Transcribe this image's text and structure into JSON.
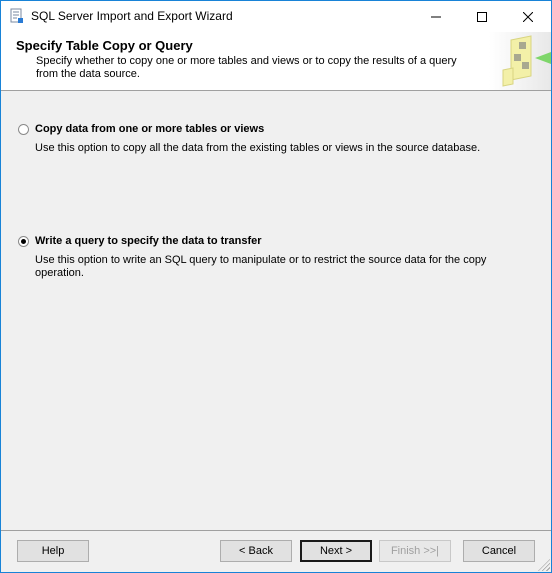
{
  "window": {
    "title": "SQL Server Import and Export Wizard"
  },
  "header": {
    "title": "Specify Table Copy or Query",
    "description": "Specify whether to copy one or more tables and views or to copy the results of a query from the data source."
  },
  "options": [
    {
      "label": "Copy data from one or more tables or views",
      "description": "Use this option to copy all the data from the existing tables or views in the source database.",
      "checked": false
    },
    {
      "label": "Write a query to specify the data to transfer",
      "description": "Use this option to write an SQL query to manipulate or to restrict the source data for the copy operation.",
      "checked": true
    }
  ],
  "buttons": {
    "help": "Help",
    "back": "< Back",
    "next": "Next >",
    "finish": "Finish >>|",
    "cancel": "Cancel"
  }
}
